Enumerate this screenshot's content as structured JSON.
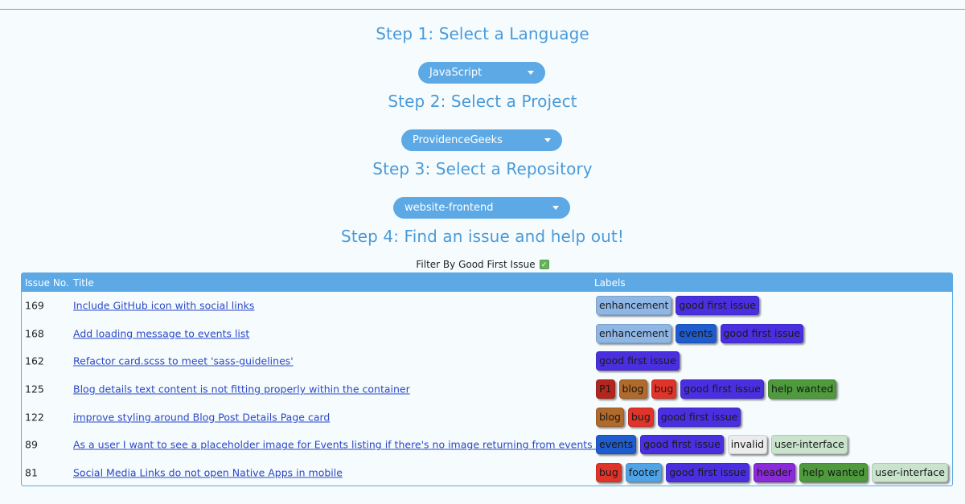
{
  "steps": {
    "step1": "Step 1: Select a Language",
    "step2": "Step 2: Select a Project",
    "step3": "Step 3: Select a Repository",
    "step4": "Step 4: Find an issue and help out!"
  },
  "selects": {
    "language": "JavaScript",
    "project": "ProvidenceGeeks",
    "repository": "website-frontend"
  },
  "filter": {
    "label": "Filter By Good First Issue",
    "checked": true,
    "check_glyph": "✓"
  },
  "table": {
    "headers": {
      "number": "Issue No.",
      "title": "Title",
      "labels": "Labels"
    },
    "rows": [
      {
        "number": "169",
        "title": "Include GitHub icon with social links",
        "labels": [
          "enhancement",
          "good first issue"
        ]
      },
      {
        "number": "168",
        "title": "Add loading message to events list",
        "labels": [
          "enhancement",
          "events",
          "good first issue"
        ]
      },
      {
        "number": "162",
        "title": "Refactor card.scss to meet 'sass-guidelines'",
        "labels": [
          "good first issue"
        ]
      },
      {
        "number": "125",
        "title": "Blog details text content is not fitting properly within the container",
        "labels": [
          "P1",
          "blog",
          "bug",
          "good first issue",
          "help wanted"
        ]
      },
      {
        "number": "122",
        "title": "improve styling around Blog Post Details Page card",
        "labels": [
          "blog",
          "bug",
          "good first issue"
        ]
      },
      {
        "number": "89",
        "title": "As a user I want to see a placeholder image for Events listing if there's no image returning from events API",
        "labels": [
          "events",
          "good first issue",
          "invalid",
          "user-interface"
        ]
      },
      {
        "number": "81",
        "title": "Social Media Links do not open Native Apps in mobile",
        "labels": [
          "bug",
          "footer",
          "good first issue",
          "header",
          "help wanted",
          "user-interface"
        ]
      }
    ]
  },
  "label_colors": {
    "enhancement": "#8fb7e6",
    "good first issue": "#4a2fe0",
    "events": "#1e5ccf",
    "P1": "#b3261e",
    "blog": "#b06a2c",
    "bug": "#e0342a",
    "help wanted": "#4e9a3c",
    "invalid": "#ececec",
    "user-interface": "#c9e3cd",
    "footer": "#4fa4e8",
    "header": "#8a2ad8"
  },
  "icons": {
    "caret": "chevron-down-icon",
    "check": "check-icon"
  }
}
